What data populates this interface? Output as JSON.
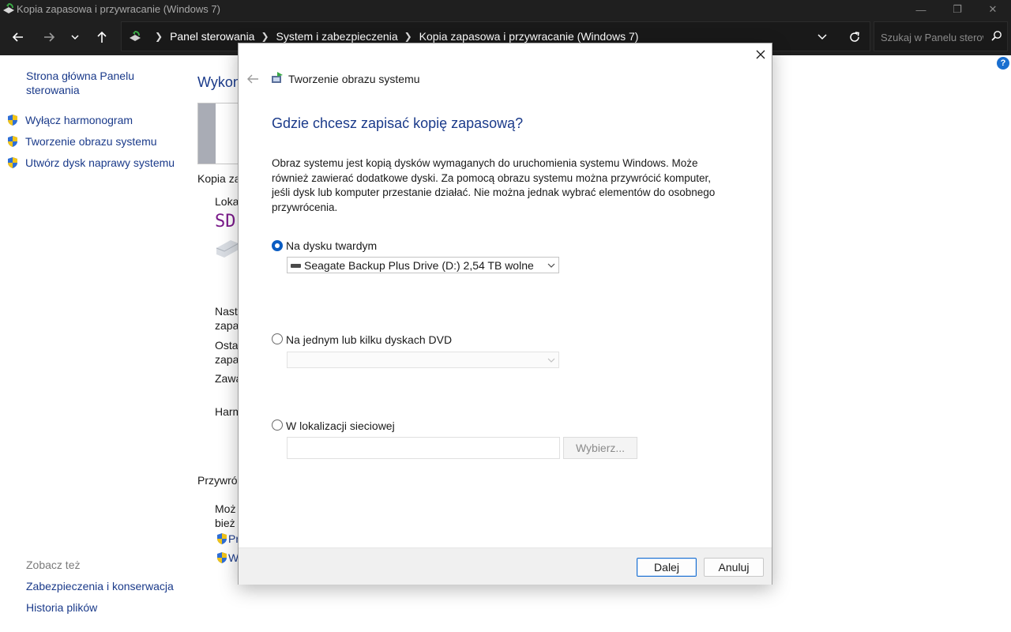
{
  "window": {
    "title": "Kopia zapasowa i przywracanie (Windows 7)",
    "controls": {
      "minimize": "—",
      "maximize": "❐",
      "close": "✕"
    }
  },
  "nav": {
    "breadcrumbs": [
      "Panel sterowania",
      "System i zabezpieczenia",
      "Kopia zapasowa i przywracanie (Windows 7)"
    ],
    "search_placeholder": "Szukaj w Panelu sterowania"
  },
  "left_panel": {
    "home_link": "Strona główna Panelu sterowania",
    "tasks": [
      "Wyłącz harmonogram",
      "Tworzenie obrazu systemu",
      "Utwórz dysk naprawy systemu"
    ],
    "see_also_heading": "Zobacz też",
    "see_also": [
      "Zabezpieczenia i konserwacja",
      "Historia plików"
    ]
  },
  "main_partial": {
    "title": "Wykon",
    "backup_label": "Kopia zap",
    "location_label": "Loka",
    "drive_text": "SD",
    "next_label_1": "Nast",
    "next_label_2": "zapa",
    "last_label_1": "Ostat",
    "last_label_2": "zapa",
    "contents_label": "Zawa",
    "schedule_label": "Harm",
    "restore_heading": "Przywró",
    "restore_text_1": "Moż",
    "restore_text_2": "bież",
    "restore_link_1": "Pr",
    "restore_link_2": "W"
  },
  "dialog": {
    "title": "Tworzenie obrazu systemu",
    "heading": "Gdzie chcesz zapisać kopię zapasową?",
    "description": "Obraz systemu jest kopią dysków wymaganych do uruchomienia systemu Windows. Może również zawierać dodatkowe dyski. Za pomocą obrazu systemu można przywrócić komputer, jeśli dysk lub komputer przestanie działać. Nie można jednak wybrać elementów do osobnego przywrócenia.",
    "options": {
      "hard_disk": {
        "label": "Na dysku twardym",
        "checked": true,
        "selected_drive": "Seagate Backup Plus Drive (D:)  2,54 TB wolne"
      },
      "dvd": {
        "label": "Na jednym lub kilku dyskach DVD",
        "checked": false,
        "selected": ""
      },
      "network": {
        "label": "W lokalizacji sieciowej",
        "checked": false,
        "path_value": "",
        "browse_label": "Wybierz..."
      }
    },
    "buttons": {
      "next": "Dalej",
      "cancel": "Anuluj"
    }
  },
  "colors": {
    "titlebar_bg": "#1f1f1f",
    "link": "#1a3a8a",
    "accent": "#0a5cc2",
    "footer_bg": "#f0f0f0"
  },
  "icons": {
    "app": "backup-restore-icon",
    "back": "arrow-left-icon",
    "forward": "arrow-right-icon",
    "recent": "chevron-down-icon",
    "up": "arrow-up-icon",
    "refresh": "refresh-icon",
    "search": "search-icon",
    "help": "help-icon",
    "shield": "uac-shield-icon"
  }
}
